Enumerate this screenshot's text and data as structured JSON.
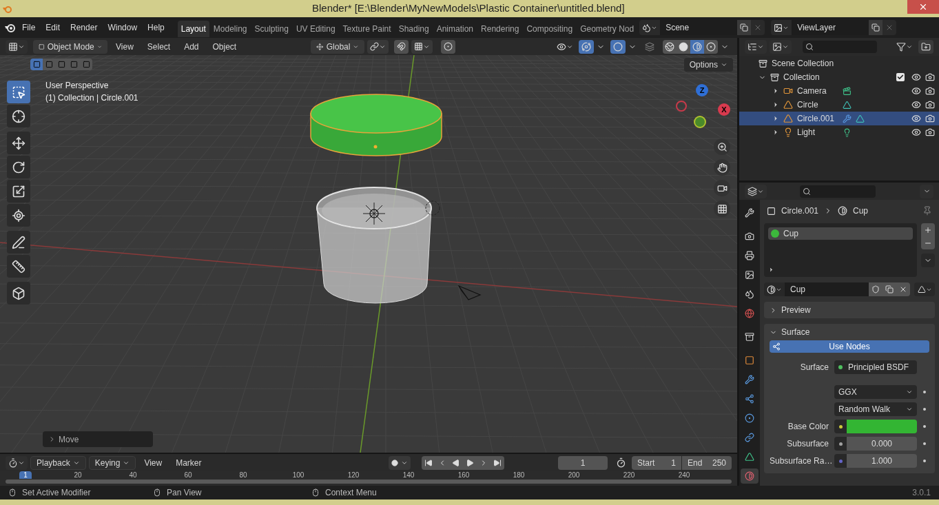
{
  "window": {
    "title": "Blender* [E:\\Blender\\MyNewModels\\Plastic Container\\untitled.blend]"
  },
  "menu": [
    "File",
    "Edit",
    "Render",
    "Window",
    "Help"
  ],
  "workspaces": [
    {
      "label": "Layout",
      "selected": true
    },
    {
      "label": "Modeling",
      "selected": false
    },
    {
      "label": "Sculpting",
      "selected": false
    },
    {
      "label": "UV Editing",
      "selected": false
    },
    {
      "label": "Texture Paint",
      "selected": false
    },
    {
      "label": "Shading",
      "selected": false
    },
    {
      "label": "Animation",
      "selected": false
    },
    {
      "label": "Rendering",
      "selected": false
    },
    {
      "label": "Compositing",
      "selected": false
    },
    {
      "label": "Geometry Nod",
      "selected": false
    }
  ],
  "scene": {
    "value": "Scene"
  },
  "view_layer": {
    "value": "ViewLayer"
  },
  "viewport_header": {
    "mode": "Object Mode",
    "menus": [
      "View",
      "Select",
      "Add",
      "Object"
    ],
    "orientation": "Global"
  },
  "select_modes": [
    {
      "selected": true
    },
    {
      "selected": false
    },
    {
      "selected": false
    },
    {
      "selected": false
    },
    {
      "selected": false
    }
  ],
  "shading_modes": [
    {
      "kind": "wireframe",
      "selected": false
    },
    {
      "kind": "solid",
      "selected": false
    },
    {
      "kind": "material",
      "selected": true
    },
    {
      "kind": "rendered",
      "selected": false
    }
  ],
  "toolbar": [
    {
      "kind": "select",
      "selected": true
    },
    {
      "kind": "cursor",
      "selected": false
    },
    {
      "kind": "move",
      "selected": false
    },
    {
      "kind": "rotate",
      "selected": false
    },
    {
      "kind": "scale",
      "selected": false
    },
    {
      "kind": "transform",
      "selected": false
    },
    {
      "kind": "annotate",
      "selected": false
    },
    {
      "kind": "measure",
      "selected": false
    },
    {
      "kind": "add_cube",
      "selected": false
    }
  ],
  "viewport": {
    "title": "User Perspective",
    "subtitle": "(1) Collection | Circle.001",
    "options": "Options",
    "last_operator": "Move",
    "gizmo": [
      "Z",
      "X"
    ]
  },
  "outliner": {
    "root": "Scene Collection",
    "collection": {
      "label": "Collection",
      "expanded": true,
      "checked": true,
      "children": [
        {
          "label": "Camera",
          "kind": "camera",
          "selected": false,
          "has_modifier": false
        },
        {
          "label": "Circle",
          "kind": "mesh",
          "selected": false,
          "has_modifier": false
        },
        {
          "label": "Circle.001",
          "kind": "mesh",
          "selected": true,
          "has_modifier": true
        },
        {
          "label": "Light",
          "kind": "light",
          "selected": false,
          "has_modifier": false
        }
      ]
    }
  },
  "properties": {
    "tabs": [
      {
        "kind": "tool",
        "selected": false
      },
      {
        "kind": "render",
        "selected": false
      },
      {
        "kind": "output",
        "selected": false
      },
      {
        "kind": "view_layer",
        "selected": false
      },
      {
        "kind": "scene",
        "selected": false
      },
      {
        "kind": "world",
        "selected": false
      },
      {
        "kind": "collection",
        "selected": false
      },
      {
        "kind": "object",
        "selected": false
      },
      {
        "kind": "modifiers",
        "selected": false
      },
      {
        "kind": "particles",
        "selected": false
      },
      {
        "kind": "physics",
        "selected": false
      },
      {
        "kind": "constraints",
        "selected": false
      },
      {
        "kind": "data",
        "selected": false
      },
      {
        "kind": "material",
        "selected": true
      }
    ],
    "breadcrumb": [
      "Circle.001",
      "Cup"
    ],
    "slots": [
      {
        "label": "Cup",
        "selected": true
      }
    ],
    "material_name": "Cup",
    "panels": [
      {
        "label": "Preview",
        "expanded": false
      },
      {
        "label": "Surface",
        "expanded": true
      }
    ],
    "use_nodes": "Use Nodes",
    "rows": [
      {
        "kind": "shader",
        "label": "Surface",
        "value": "Principled BSDF"
      },
      {
        "kind": "dropdown",
        "value": "GGX"
      },
      {
        "kind": "dropdown",
        "value": "Random Walk"
      },
      {
        "kind": "color",
        "label": "Base Color",
        "color": "#33b533"
      },
      {
        "kind": "number",
        "label": "Subsurface",
        "value": "0.000"
      },
      {
        "kind": "number",
        "label": "Subsurface Ra…",
        "value": "1.000"
      }
    ]
  },
  "timeline": {
    "menus": [
      "Playback",
      "Keying",
      "View",
      "Marker"
    ],
    "current_frame": "1",
    "start": {
      "label": "Start",
      "value": "1"
    },
    "end": {
      "label": "End",
      "value": "250"
    },
    "ruler": [
      "1",
      "20",
      "40",
      "60",
      "80",
      "100",
      "120",
      "140",
      "160",
      "180",
      "200",
      "220",
      "240"
    ]
  },
  "status_bar": {
    "hints": [
      "Set Active Modifier",
      "Pan View",
      "Context Menu"
    ],
    "version": "3.0.1"
  }
}
